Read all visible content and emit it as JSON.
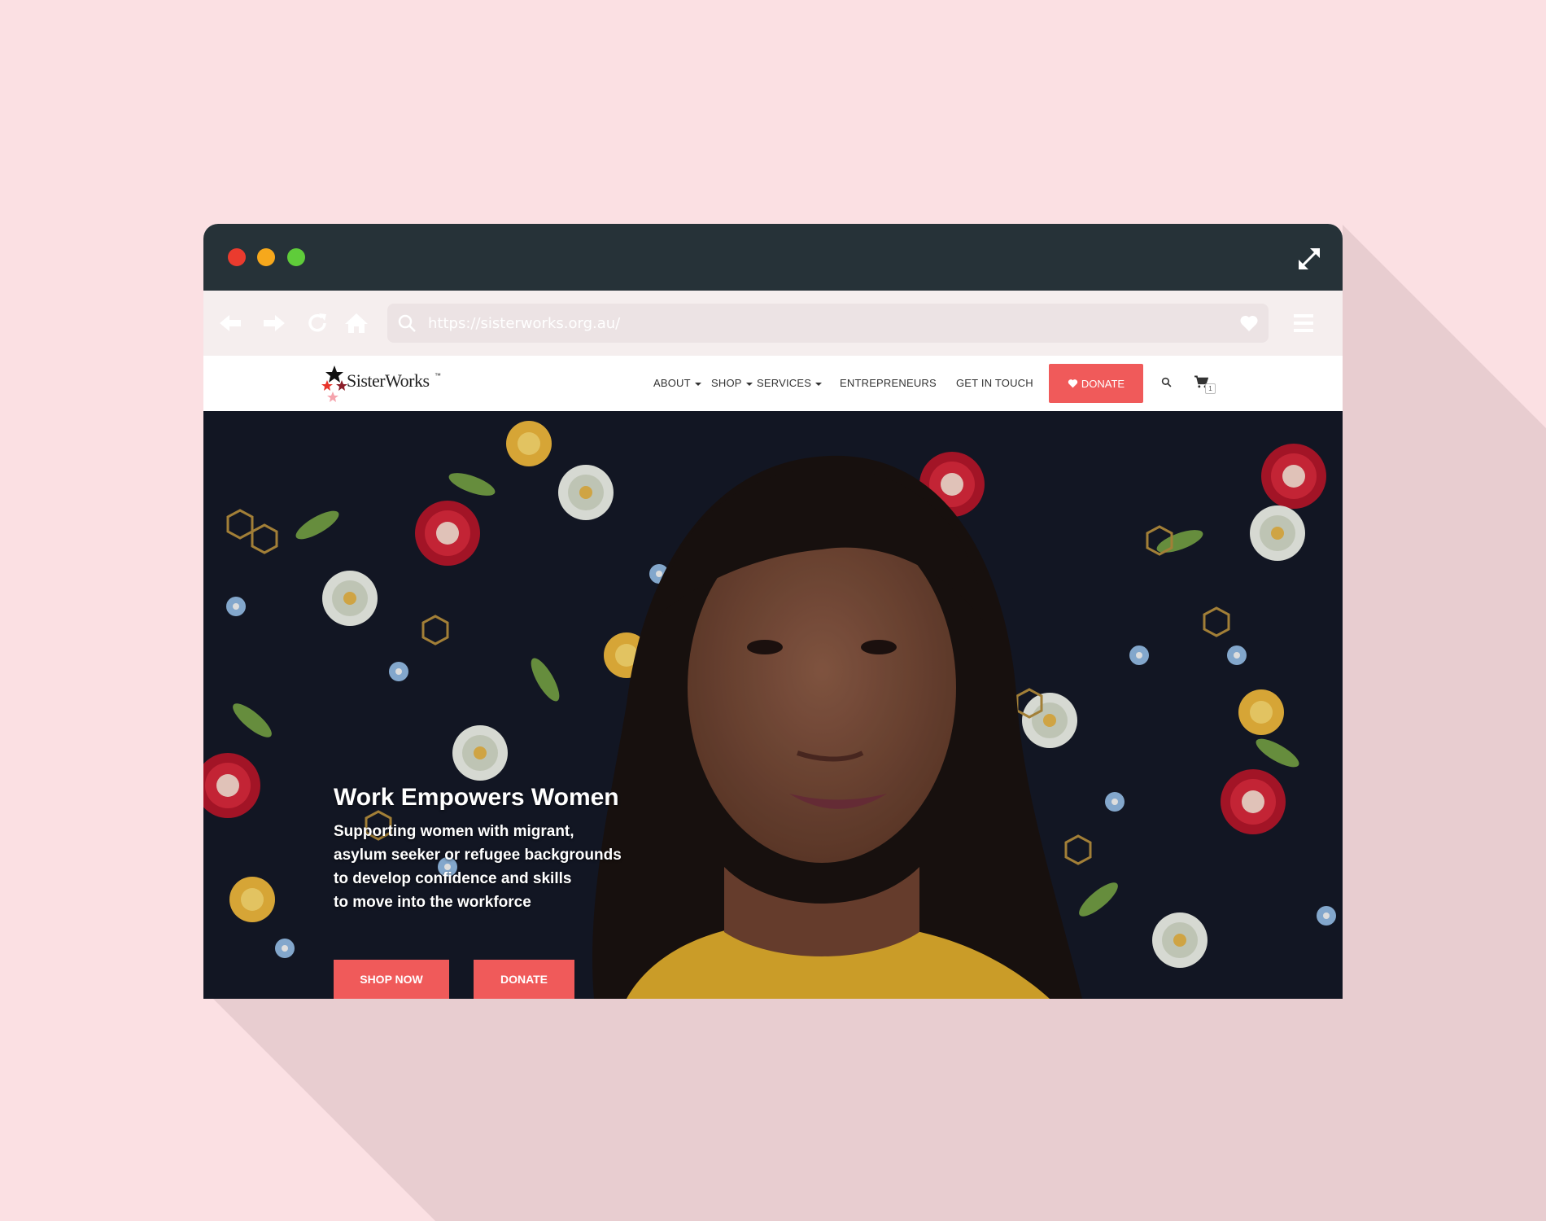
{
  "browser": {
    "url": "https://sisterworks.org.au/"
  },
  "site": {
    "logo_text": "SisterWorks",
    "logo_mark": "™",
    "nav": {
      "about": "ABOUT",
      "shop": "SHOP",
      "services": "SERVICES",
      "entrepreneurs": "ENTREPRENEURS",
      "get_in_touch": "GET IN TOUCH",
      "donate": "DONATE",
      "cart_count": "1"
    }
  },
  "hero": {
    "title": "Work Empowers Women",
    "subtitle_lines": [
      "Supporting women with migrant,",
      "asylum seeker or refugee backgrounds",
      "to develop confidence and skills",
      "to move into the workforce"
    ],
    "shop_button": "SHOP NOW",
    "donate_button": "DONATE"
  },
  "colors": {
    "background": "#fbe0e3",
    "titlebar": "#263238",
    "accent": "#f05a5a"
  }
}
